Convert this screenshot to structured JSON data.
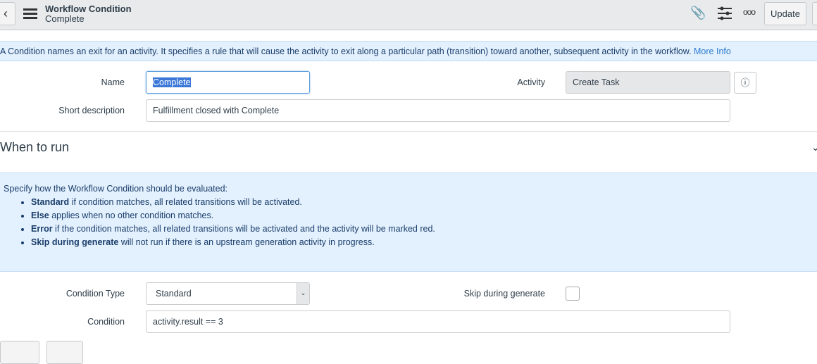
{
  "header": {
    "title": "Workflow Condition",
    "subtitle": "Complete",
    "update_label": "Update"
  },
  "info": {
    "text": "A Condition names an exit for an activity. It specifies a rule that will cause the activity to exit along a particular path (transition) toward another, subsequent activity in the workflow.",
    "link": "More Info"
  },
  "form": {
    "name_label": "Name",
    "name_value": "Complete",
    "activity_label": "Activity",
    "activity_value": "Create Task",
    "short_desc_label": "Short description",
    "short_desc_value": "Fulfillment closed with Complete",
    "section_title": "When to run",
    "condition_type_label": "Condition Type",
    "condition_type_value": "Standard",
    "skip_label": "Skip during generate",
    "skip_checked": false,
    "condition_label": "Condition",
    "condition_value": "activity.result == 3"
  },
  "help": {
    "intro": "Specify how the Workflow Condition should be evaluated:",
    "items": [
      {
        "bold": "Standard",
        "text": " if condition matches, all related transitions will be activated."
      },
      {
        "bold": "Else",
        "text": " applies when no other condition matches."
      },
      {
        "bold": "Error",
        "text": " if the condition matches, all related transitions will be activated and the activity will be marked red."
      },
      {
        "bold": "Skip during generate",
        "text": " will not run if there is an upstream generation activity in progress."
      }
    ]
  }
}
